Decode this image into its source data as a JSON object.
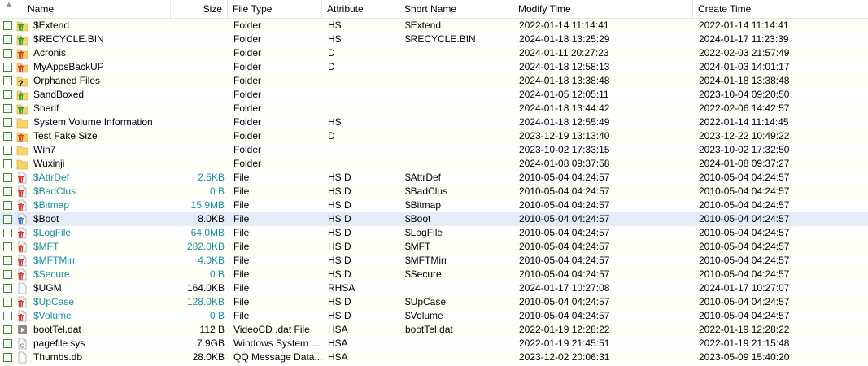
{
  "columns": {
    "name": "Name",
    "size": "Size",
    "type": "File Type",
    "attr": "Attribute",
    "short": "Short Name",
    "modify": "Modify Time",
    "create": "Create Time"
  },
  "colors": {
    "folder": "#f5d46b",
    "green_bin": "#2e9a2e",
    "red_bin": "#d9362b",
    "meta_text": "#1c8fa0",
    "selected_row": "#e3ecf8",
    "checkbox_border": "#3b8a2e"
  },
  "rows": [
    {
      "name": "$Extend",
      "size": "",
      "type": "Folder",
      "attr": "HS",
      "short": "$Extend",
      "modify": "2022-01-14 11:14:41",
      "create": "2022-01-14 11:14:41",
      "icon": "folder-green-bin-icon",
      "meta": false
    },
    {
      "name": "$RECYCLE.BIN",
      "size": "",
      "type": "Folder",
      "attr": "HS",
      "short": "$RECYCLE.BIN",
      "modify": "2024-01-18 13:25:29",
      "create": "2024-01-17 11:23:39",
      "icon": "folder-green-bin-icon",
      "meta": false
    },
    {
      "name": "Acronis",
      "size": "",
      "type": "Folder",
      "attr": "D",
      "short": "",
      "modify": "2024-01-11 20:27:23",
      "create": "2022-02-03 21:57:49",
      "icon": "folder-red-bin-icon",
      "meta": false
    },
    {
      "name": "MyAppsBackUP",
      "size": "",
      "type": "Folder",
      "attr": "D",
      "short": "",
      "modify": "2024-01-18 12:58:13",
      "create": "2024-01-03 14:01:17",
      "icon": "folder-red-bin-icon",
      "meta": false
    },
    {
      "name": "Orphaned Files",
      "size": "",
      "type": "Folder",
      "attr": "",
      "short": "",
      "modify": "2024-01-18 13:38:48",
      "create": "2024-01-18 13:38:48",
      "icon": "folder-question-icon",
      "meta": false
    },
    {
      "name": "SandBoxed",
      "size": "",
      "type": "Folder",
      "attr": "",
      "short": "",
      "modify": "2024-01-05 12:05:11",
      "create": "2023-10-04 09:20:50",
      "icon": "folder-green-bin-icon",
      "meta": false
    },
    {
      "name": "Sherif",
      "size": "",
      "type": "Folder",
      "attr": "",
      "short": "",
      "modify": "2024-01-18 13:44:42",
      "create": "2022-02-06 14:42:57",
      "icon": "folder-green-bin-icon",
      "meta": false
    },
    {
      "name": "System Volume Information",
      "size": "",
      "type": "Folder",
      "attr": "HS",
      "short": "",
      "modify": "2024-01-18 12:55:49",
      "create": "2022-01-14 11:14:45",
      "icon": "folder-icon",
      "meta": false
    },
    {
      "name": "Test Fake Size",
      "size": "",
      "type": "Folder",
      "attr": "D",
      "short": "",
      "modify": "2023-12-19 13:13:40",
      "create": "2023-12-22 10:49:22",
      "icon": "folder-red-bin-icon",
      "meta": false
    },
    {
      "name": "Win7",
      "size": "",
      "type": "Folder",
      "attr": "",
      "short": "",
      "modify": "2023-10-02 17:33:15",
      "create": "2023-10-02 17:32:50",
      "icon": "folder-icon",
      "meta": false
    },
    {
      "name": "Wuxinji",
      "size": "",
      "type": "Folder",
      "attr": "",
      "short": "",
      "modify": "2024-01-08 09:37:58",
      "create": "2024-01-08 09:37:27",
      "icon": "folder-icon",
      "meta": false
    },
    {
      "name": "$AttrDef",
      "size": "2.5KB",
      "type": "File",
      "attr": "HS D",
      "short": "$AttrDef",
      "modify": "2010-05-04 04:24:57",
      "create": "2010-05-04 04:24:57",
      "icon": "file-red-bin-icon",
      "meta": true
    },
    {
      "name": "$BadClus",
      "size": "0 B",
      "type": "File",
      "attr": "HS D",
      "short": "$BadClus",
      "modify": "2010-05-04 04:24:57",
      "create": "2010-05-04 04:24:57",
      "icon": "file-red-bin-icon",
      "meta": true
    },
    {
      "name": "$Bitmap",
      "size": "15.9MB",
      "type": "File",
      "attr": "HS D",
      "short": "$Bitmap",
      "modify": "2010-05-04 04:24:57",
      "create": "2010-05-04 04:24:57",
      "icon": "file-red-bin-icon",
      "meta": true
    },
    {
      "name": "$Boot",
      "size": "8.0KB",
      "type": "File",
      "attr": "HS D",
      "short": "$Boot",
      "modify": "2010-05-04 04:24:57",
      "create": "2010-05-04 04:24:57",
      "icon": "file-blue-bin-icon",
      "meta": false,
      "selected": true
    },
    {
      "name": "$LogFile",
      "size": "64.0MB",
      "type": "File",
      "attr": "HS D",
      "short": "$LogFile",
      "modify": "2010-05-04 04:24:57",
      "create": "2010-05-04 04:24:57",
      "icon": "file-red-bin-icon",
      "meta": true
    },
    {
      "name": "$MFT",
      "size": "282.0KB",
      "type": "File",
      "attr": "HS D",
      "short": "$MFT",
      "modify": "2010-05-04 04:24:57",
      "create": "2010-05-04 04:24:57",
      "icon": "file-red-bin-icon",
      "meta": true
    },
    {
      "name": "$MFTMirr",
      "size": "4.0KB",
      "type": "File",
      "attr": "HS D",
      "short": "$MFTMirr",
      "modify": "2010-05-04 04:24:57",
      "create": "2010-05-04 04:24:57",
      "icon": "file-red-bin-icon",
      "meta": true
    },
    {
      "name": "$Secure",
      "size": "0 B",
      "type": "File",
      "attr": "HS D",
      "short": "$Secure",
      "modify": "2010-05-04 04:24:57",
      "create": "2010-05-04 04:24:57",
      "icon": "file-red-bin-icon",
      "meta": true
    },
    {
      "name": "$UGM",
      "size": "164.0KB",
      "type": "File",
      "attr": "RHSA",
      "short": "",
      "modify": "2024-01-17 10:27:08",
      "create": "2024-01-17 10:27:07",
      "icon": "file-icon",
      "meta": false
    },
    {
      "name": "$UpCase",
      "size": "128.0KB",
      "type": "File",
      "attr": "HS D",
      "short": "$UpCase",
      "modify": "2010-05-04 04:24:57",
      "create": "2010-05-04 04:24:57",
      "icon": "file-red-bin-icon",
      "meta": true
    },
    {
      "name": "$Volume",
      "size": "0 B",
      "type": "File",
      "attr": "HS D",
      "short": "$Volume",
      "modify": "2010-05-04 04:24:57",
      "create": "2010-05-04 04:24:57",
      "icon": "file-red-bin-icon",
      "meta": true
    },
    {
      "name": "bootTel.dat",
      "size": "112 B",
      "type": "VideoCD .dat File",
      "attr": "HSA",
      "short": "bootTel.dat",
      "modify": "2022-01-19 12:28:22",
      "create": "2022-01-19 12:28:22",
      "icon": "video-file-icon",
      "meta": false
    },
    {
      "name": "pagefile.sys",
      "size": "7.9GB",
      "type": "Windows System ...",
      "attr": "HSA",
      "short": "",
      "modify": "2022-01-19 21:45:51",
      "create": "2022-01-19 21:15:48",
      "icon": "system-file-icon",
      "meta": false
    },
    {
      "name": "Thumbs.db",
      "size": "28.0KB",
      "type": "QQ Message Data...",
      "attr": "HSA",
      "short": "",
      "modify": "2023-12-02 20:06:31",
      "create": "2023-05-09 15:40:20",
      "icon": "file-icon",
      "meta": false
    }
  ]
}
